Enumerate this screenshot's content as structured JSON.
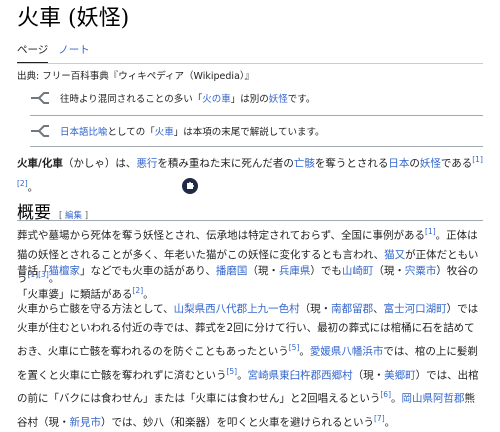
{
  "title": "火車 (妖怪)",
  "tabs": [
    "ページ",
    "ノート"
  ],
  "source": "出典: フリー百科事典『ウィキペディア（Wikipedia）』",
  "hatnote1": {
    "a": "往時より混同されることの多い「",
    "b": "火の車",
    "c": "」は別の",
    "d": "妖怪",
    "e": "です。"
  },
  "hatnote2": {
    "a": "日本語比喩",
    "b": "としての「",
    "c": "火車",
    "d": "」は本項の末尾で解説しています。"
  },
  "lead": {
    "a": "火車/化車",
    "b": "（かしゃ）は、",
    "c": "悪行",
    "d": "を積み重ねた末に死んだ者の",
    "e": "亡骸",
    "f": "を奪うとされる",
    "g": "日本",
    "h": "の",
    "i": "妖怪",
    "j": "である",
    "k": "[1]",
    "l": "[2]",
    "m": "。"
  },
  "section": {
    "heading": "概要",
    "edit_open": "[ ",
    "edit": "編集",
    "edit_close": " ]"
  },
  "para1": {
    "a": "葬式や墓場から死体を奪う妖怪とされ、伝承地は特定されておらず、全国に事例がある",
    "b": "[1]",
    "c": "。正体は猫の妖怪とされることが多く、年老いた猫がこの妖怪に変化するとも言われ、",
    "d": "猫又",
    "e": "が正体だともいう",
    "f": "[1][3]",
    "g": "。"
  },
  "para2": {
    "a": "昔話「",
    "b": "猫檀家",
    "c": "」などでも火車の話があり、",
    "d": "播磨国",
    "e": "（現・",
    "f": "兵庫県",
    "g": "）でも",
    "h": "山崎町",
    "i": "（現・",
    "j": "宍粟市",
    "k": "）牧谷の「火車婆」に類話がある",
    "l": "[2]",
    "m": "。"
  },
  "para3": {
    "a": "火車から亡骸を守る方法として、",
    "b": "山梨県西八代郡上九一色村",
    "c": "（現・",
    "d": "南都留郡",
    "e": "、",
    "f": "富士河口湖町",
    "g": "）では火車が住むといわれる付近の寺では、葬式を2回に分けて行い、最初の葬式には棺桶に石を詰めておき、火車に亡骸を奪われるのを防ぐこともあったという",
    "h": "[5]",
    "i": "。",
    "j": "愛媛県八幡浜市",
    "k": "では、棺の上に髪剃を置くと火車に亡骸を奪われずに済むという",
    "l": "[5]",
    "m": "。",
    "n": "宮崎県東臼杵郡西郷村",
    "o": "（現・",
    "p": "美郷町",
    "q": "）では、出棺の前に「バクには食わせん」または「火車には食わせん」と2回唱えるという",
    "r": "[6]",
    "s": "。",
    "t": "岡山県阿哲郡",
    "u": "熊谷村（現・",
    "v": "新見市",
    "w": "）では、妙八（和楽器）を叩くと火車を避けられるという",
    "x": "[7]",
    "y": "。"
  }
}
